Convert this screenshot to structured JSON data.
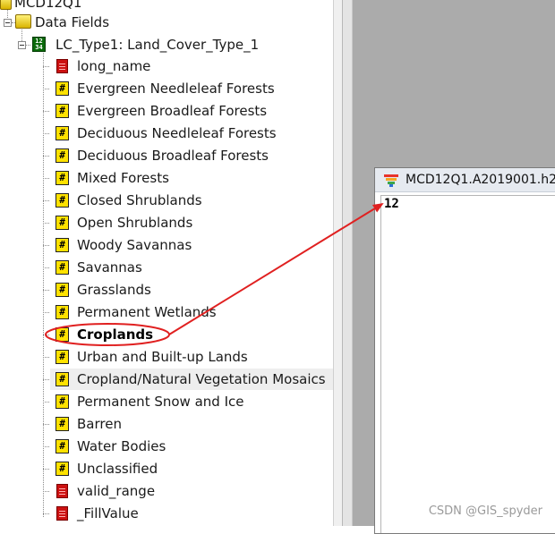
{
  "tree": {
    "root_label": "MCD12Q1",
    "group_label": "Data Fields",
    "dataset_label": "LC_Type1: Land_Cover_Type_1",
    "items": [
      {
        "label": "long_name",
        "icon": "attribute-icon",
        "bold": false,
        "highlight": false
      },
      {
        "label": "Evergreen Needleleaf Forests",
        "icon": "hash-icon",
        "bold": false,
        "highlight": false
      },
      {
        "label": "Evergreen Broadleaf Forests",
        "icon": "hash-icon",
        "bold": false,
        "highlight": false
      },
      {
        "label": "Deciduous Needleleaf Forests",
        "icon": "hash-icon",
        "bold": false,
        "highlight": false
      },
      {
        "label": "Deciduous Broadleaf Forests",
        "icon": "hash-icon",
        "bold": false,
        "highlight": false
      },
      {
        "label": "Mixed Forests",
        "icon": "hash-icon",
        "bold": false,
        "highlight": false
      },
      {
        "label": "Closed Shrublands",
        "icon": "hash-icon",
        "bold": false,
        "highlight": false
      },
      {
        "label": "Open Shrublands",
        "icon": "hash-icon",
        "bold": false,
        "highlight": false
      },
      {
        "label": "Woody Savannas",
        "icon": "hash-icon",
        "bold": false,
        "highlight": false
      },
      {
        "label": "Savannas",
        "icon": "hash-icon",
        "bold": false,
        "highlight": false
      },
      {
        "label": "Grasslands",
        "icon": "hash-icon",
        "bold": false,
        "highlight": false
      },
      {
        "label": "Permanent Wetlands",
        "icon": "hash-icon",
        "bold": false,
        "highlight": false
      },
      {
        "label": "Croplands",
        "icon": "hash-icon",
        "bold": true,
        "highlight": false
      },
      {
        "label": "Urban and Built-up Lands",
        "icon": "hash-icon",
        "bold": false,
        "highlight": false
      },
      {
        "label": "Cropland/Natural Vegetation Mosaics",
        "icon": "hash-icon",
        "bold": false,
        "highlight": true
      },
      {
        "label": "Permanent Snow and Ice",
        "icon": "hash-icon",
        "bold": false,
        "highlight": false
      },
      {
        "label": "Barren",
        "icon": "hash-icon",
        "bold": false,
        "highlight": false
      },
      {
        "label": "Water Bodies",
        "icon": "hash-icon",
        "bold": false,
        "highlight": false
      },
      {
        "label": "Unclassified",
        "icon": "hash-icon",
        "bold": false,
        "highlight": false
      },
      {
        "label": "valid_range",
        "icon": "attribute-icon",
        "bold": false,
        "highlight": false
      },
      {
        "label": "_FillValue",
        "icon": "attribute-icon",
        "bold": false,
        "highlight": false
      }
    ]
  },
  "image_window": {
    "title": "MCD12Q1.A2019001.h2",
    "pixel_value": "12"
  },
  "annotation": {
    "color": "#e02020",
    "target": "Croplands"
  },
  "watermark": "CSDN @GIS_spyder"
}
